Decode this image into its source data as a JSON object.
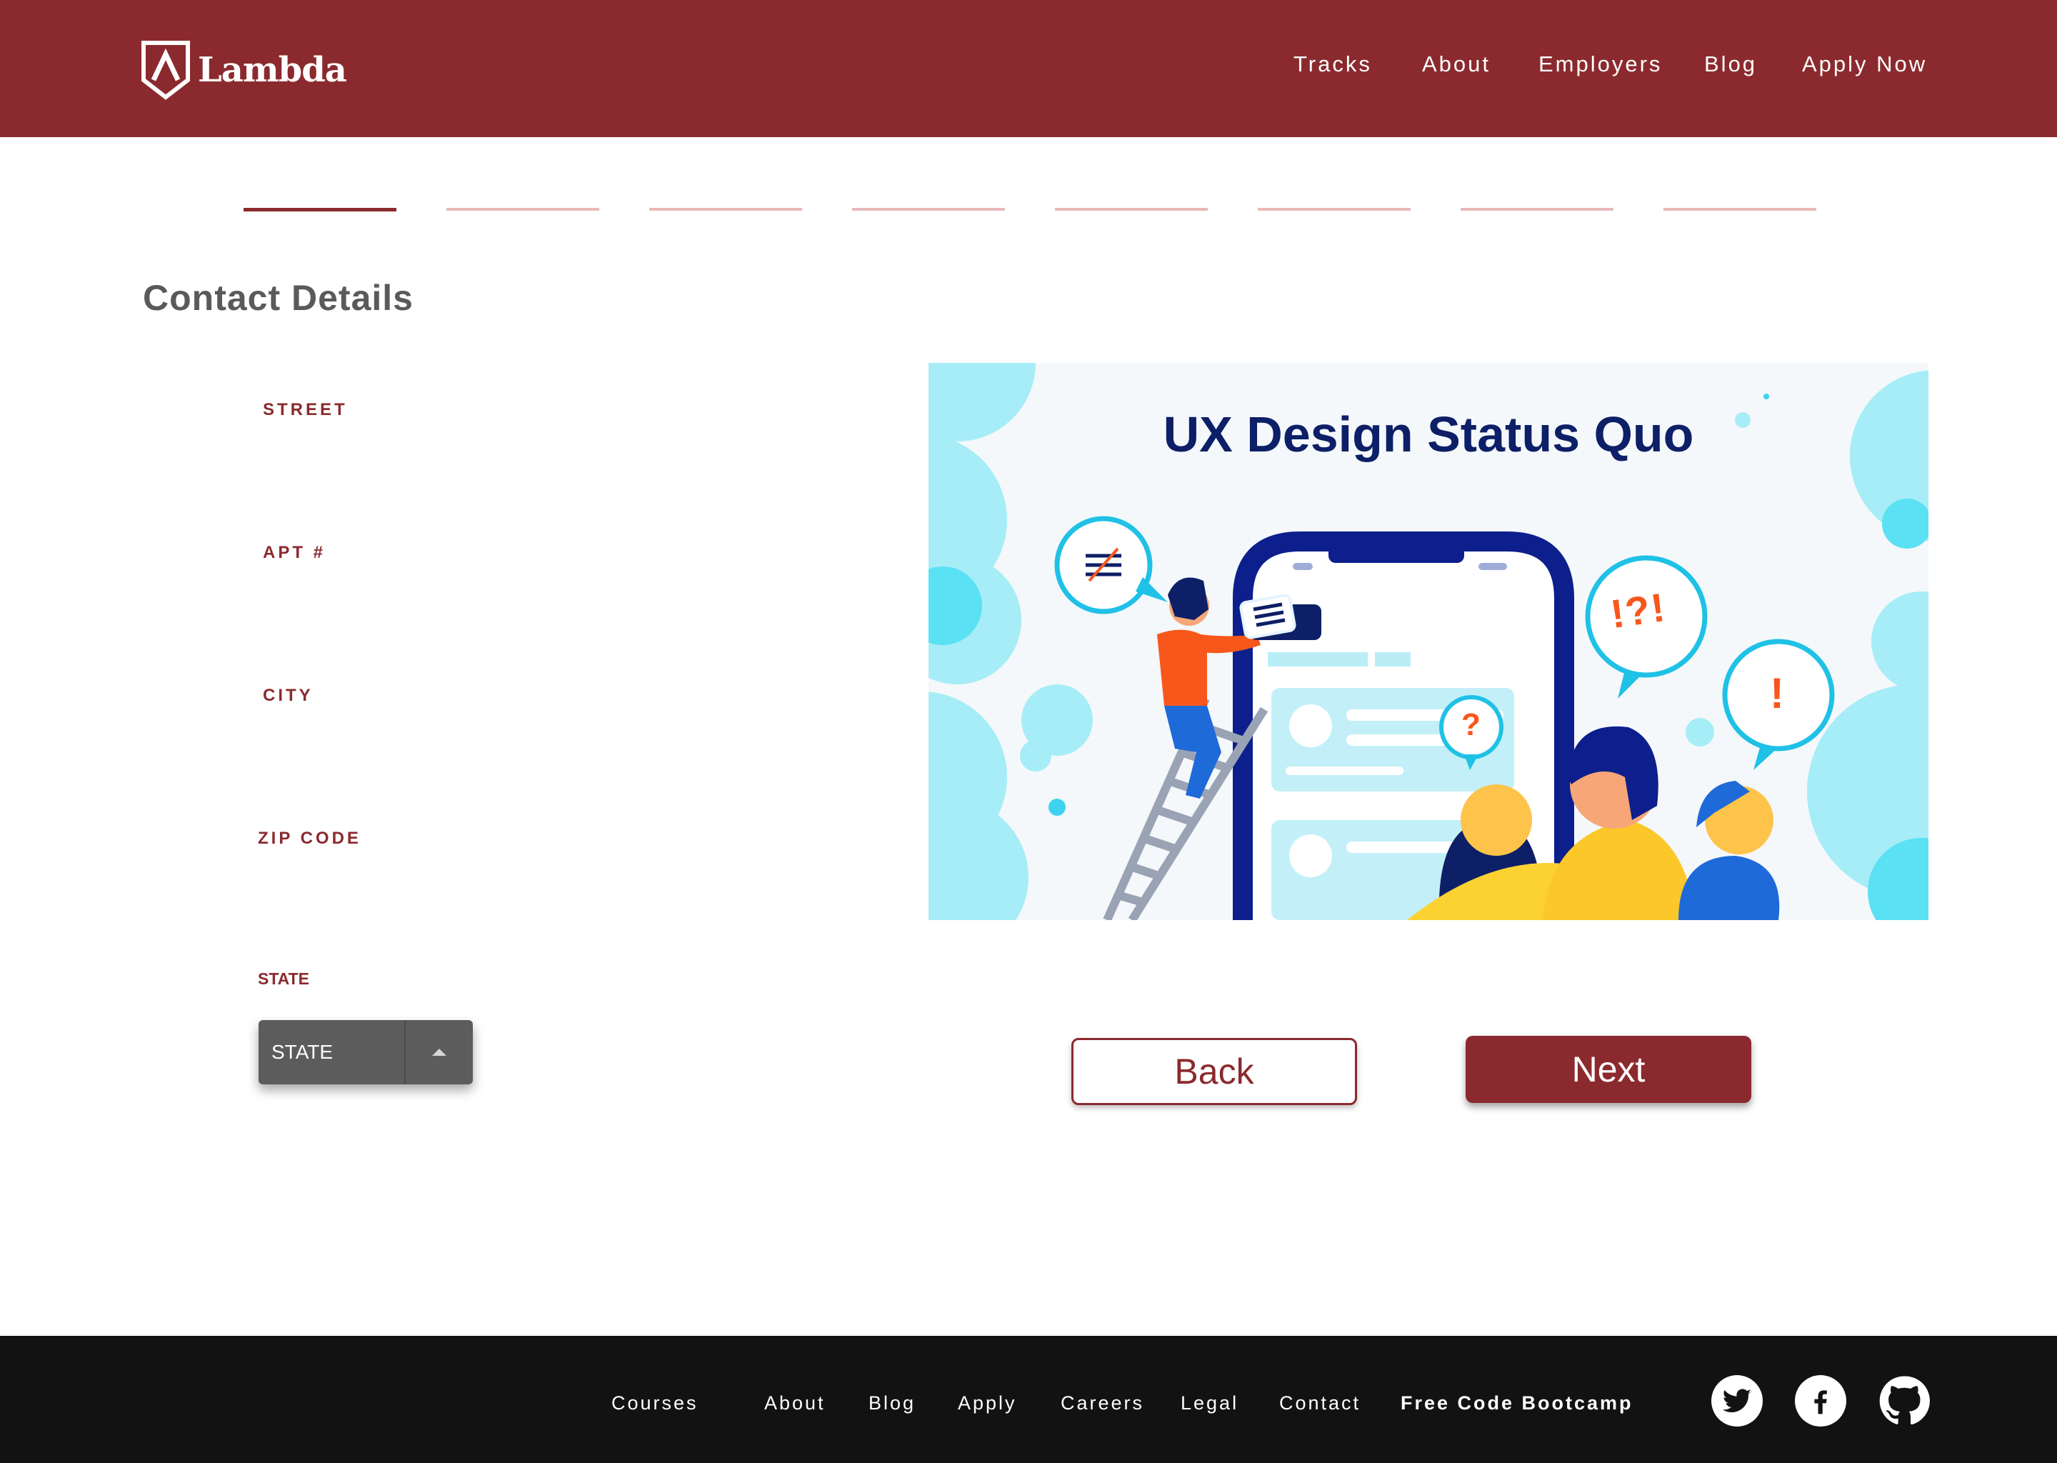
{
  "header": {
    "logo_text": "Lambda",
    "nav": [
      "Tracks",
      "About",
      "Employers",
      "Blog",
      "Apply Now"
    ]
  },
  "progress": {
    "total_steps": 8,
    "current_step": 1
  },
  "page_title": "Contact Details",
  "form": {
    "street_label": "STREET",
    "apt_label": "APT #",
    "city_label": "CITY",
    "zip_label": "ZIP CODE",
    "state_label": "STATE",
    "state_value": "STATE"
  },
  "illustration": {
    "title": "UX Design Status Quo",
    "bubble_1": "!?!",
    "bubble_2": "?",
    "bubble_3": "!"
  },
  "buttons": {
    "back": "Back",
    "next": "Next"
  },
  "footer": {
    "links": [
      "Courses",
      "About",
      "Blog",
      "Apply",
      "Careers",
      "Legal",
      "Contact"
    ],
    "bootcamp": "Free Code Bootcamp"
  },
  "colors": {
    "brand": "#8b2a2e",
    "step_inactive": "#e8b9ba",
    "footer_bg": "#121212",
    "illustration_title": "#0d1f66"
  },
  "icons": [
    "lambda-logo-icon",
    "twitter-icon",
    "facebook-icon",
    "github-icon"
  ]
}
